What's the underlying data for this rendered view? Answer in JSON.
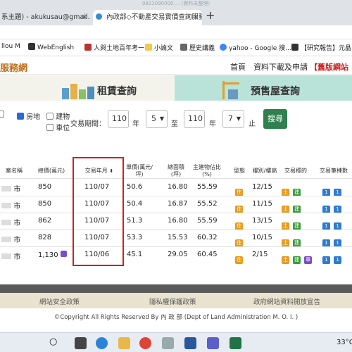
{
  "window": {
    "title": "0821090000 ... (資料未整理)"
  },
  "tabs": [
    {
      "label": "系主題) - akukusau@gmail.co",
      "close": "×"
    },
    {
      "label": "內政部◇不動產交易實價查詢服務",
      "close": "×"
    }
  ],
  "new_tab": "+",
  "bookmarks": [
    "llou M",
    "WebEnglish",
    "人與土地百年考一...",
    "小論文",
    "歷史講義",
    "yahoo - Google 搜...",
    "【研究報告】元晶 ("
  ],
  "site": {
    "brand": "服務網",
    "nav": [
      "首頁",
      "資料下載及申請",
      "【舊版網站"
    ]
  },
  "banner": {
    "left": "租賃查詢",
    "right": "預售屋查詢"
  },
  "filters": {
    "types": [
      {
        "label": "房地",
        "checked": true
      },
      {
        "label": "建物",
        "checked": false
      },
      {
        "label": "車位",
        "checked": false
      }
    ],
    "period_label": "交易期間：",
    "from_year": "110",
    "year_unit_1": "年",
    "from_month": "5",
    "to_label": "至",
    "to_year": "110",
    "year_unit_2": "年",
    "to_month": "7",
    "end_label": "止",
    "search": "搜尋"
  },
  "table": {
    "headers": [
      "案名稱",
      "總價(萬元)",
      "交易年月",
      "單價(萬元/坪)",
      "總面積(坪)",
      "主建物佔比(%)",
      "型態",
      "樓別/樓高",
      "交易標的",
      "交易筆棟數"
    ],
    "rows": [
      {
        "name": "市",
        "total": "850",
        "ym": "110/07",
        "unit": "50.6",
        "area": "16.80",
        "ratio": "55.59",
        "floor": "12/15"
      },
      {
        "name": "市",
        "total": "850",
        "ym": "110/07",
        "unit": "50.4",
        "area": "16.87",
        "ratio": "55.52",
        "floor": "11/15"
      },
      {
        "name": "市",
        "total": "862",
        "ym": "110/07",
        "unit": "51.3",
        "area": "16.80",
        "ratio": "55.59",
        "floor": "13/15"
      },
      {
        "name": "市",
        "total": "828",
        "ym": "110/07",
        "unit": "53.3",
        "area": "15.53",
        "ratio": "60.32",
        "floor": "10/15"
      },
      {
        "name": "市",
        "total": "1,130",
        "ym": "110/06",
        "unit": "45.1",
        "area": "29.05",
        "ratio": "60.45",
        "floor": "2/15"
      }
    ],
    "badge_labels": {
      "type": "住",
      "land": "土",
      "building": "建",
      "parking": "車",
      "count1": "1",
      "count2": "1"
    }
  },
  "footer": {
    "links": [
      "網站安全政策",
      "隱私權保護政策",
      "政府網站資料開放宣告"
    ],
    "copyright": "©Copyright All Rights Reserved By 內 政 部 (Dept of Land Administration M. O. I. )"
  },
  "taskbar": {
    "weather": "33°C"
  },
  "colors": {
    "highlight": "#d01f1f",
    "brand": "#c0701b",
    "search": "#2f7f4f"
  }
}
